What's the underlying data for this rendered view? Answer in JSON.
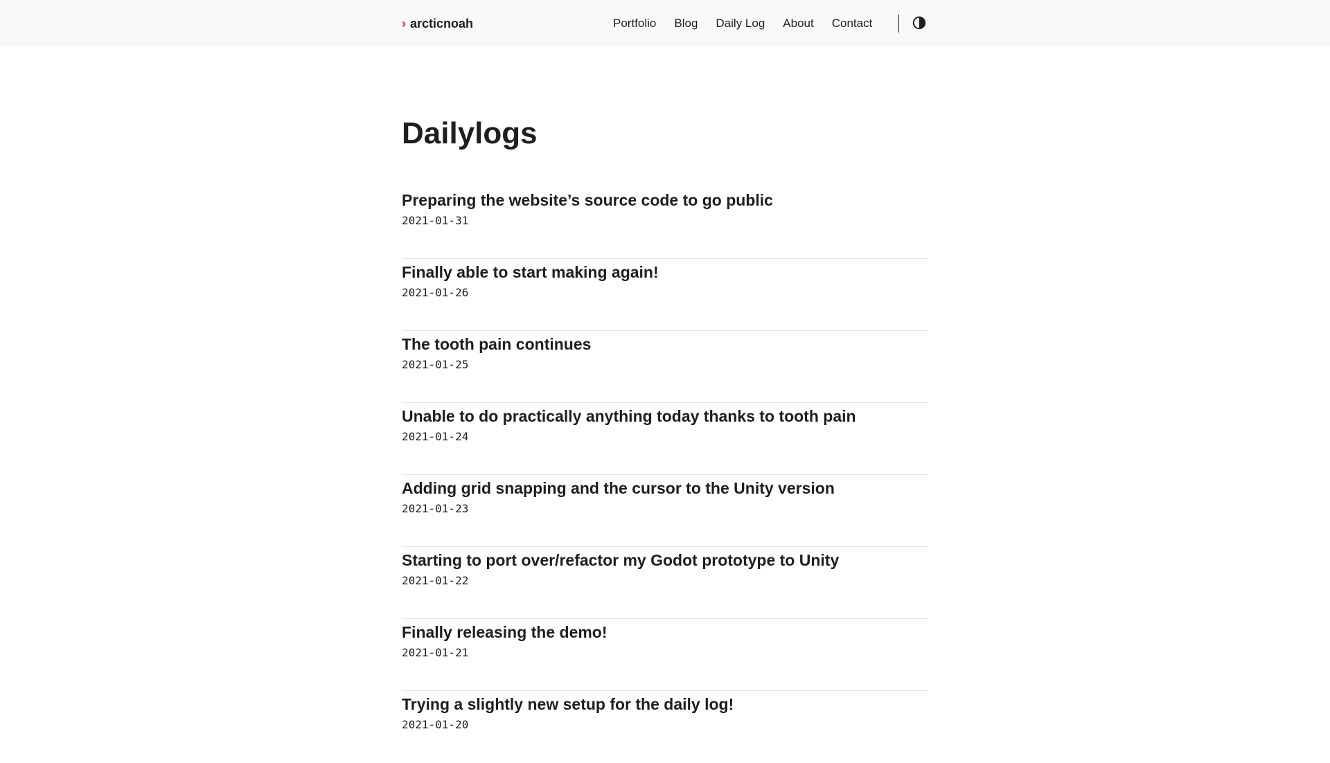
{
  "header": {
    "brand_chevron": "›",
    "brand_name": "arcticnoah",
    "nav": [
      "Portfolio",
      "Blog",
      "Daily Log",
      "About",
      "Contact"
    ],
    "theme_toggle_icon": "half-circle-contrast-icon"
  },
  "main": {
    "title": "Dailylogs",
    "posts": [
      {
        "title": "Preparing the website’s source code to go public",
        "date": "2021-01-31"
      },
      {
        "title": "Finally able to start making again!",
        "date": "2021-01-26"
      },
      {
        "title": "The tooth pain continues",
        "date": "2021-01-25"
      },
      {
        "title": "Unable to do practically anything today thanks to tooth pain",
        "date": "2021-01-24"
      },
      {
        "title": "Adding grid snapping and the cursor to the Unity version",
        "date": "2021-01-23"
      },
      {
        "title": "Starting to port over/refactor my Godot prototype to Unity",
        "date": "2021-01-22"
      },
      {
        "title": "Finally releasing the demo!",
        "date": "2021-01-21"
      },
      {
        "title": "Trying a slightly new setup for the daily log!",
        "date": "2021-01-20"
      }
    ]
  },
  "colors": {
    "accent": "#e8175d",
    "text": "#1e1e1e",
    "header_bg": "#f9f9f9",
    "divider": "#e6e6e6"
  }
}
